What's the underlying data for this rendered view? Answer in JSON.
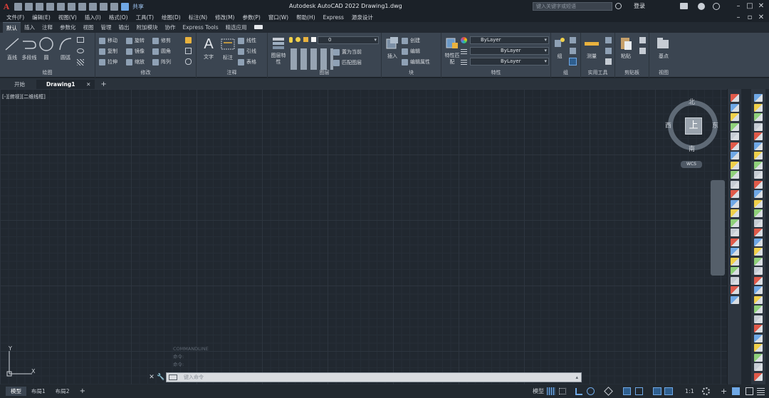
{
  "app": {
    "logo": "A",
    "title": "Autodesk AutoCAD 2022    Drawing1.dwg",
    "share": "共享",
    "search_placeholder": "键入关键字或短语",
    "login": "登录"
  },
  "menu": [
    "文件(F)",
    "编辑(E)",
    "视图(V)",
    "插入(I)",
    "格式(O)",
    "工具(T)",
    "绘图(D)",
    "标注(N)",
    "修改(M)",
    "参数(P)",
    "窗口(W)",
    "帮助(H)",
    "Express",
    "源泉设计"
  ],
  "ribbon_tabs": [
    "默认",
    "插入",
    "注释",
    "参数化",
    "视图",
    "管理",
    "输出",
    "附加模块",
    "协作",
    "Express Tools",
    "精选应用"
  ],
  "ribbon": {
    "draw": {
      "label": "绘图",
      "line": "直线",
      "polyline": "多段线",
      "circle": "圆",
      "arc": "圆弧"
    },
    "modify": {
      "label": "修改",
      "move": "移动",
      "rotate": "旋转",
      "trim": "修剪",
      "copy": "复制",
      "mirror": "镜像",
      "fillet": "圆角",
      "stretch": "拉伸",
      "scale": "缩放",
      "array": "阵列"
    },
    "annotation": {
      "label": "注释",
      "text": "文字",
      "dimension": "标注",
      "linear": "线性",
      "leader": "引线",
      "table": "表格"
    },
    "layers": {
      "label": "图层",
      "layer_props": "图层特性",
      "current_layer": "0",
      "make_current": "置为当前",
      "match_layer": "匹配图层"
    },
    "block": {
      "label": "块",
      "insert": "插入",
      "create": "创建",
      "edit": "编辑",
      "edit_attr": "编辑属性"
    },
    "properties": {
      "label": "特性",
      "match": "特性匹配",
      "color": "ByLayer",
      "linetype": "ByLayer",
      "lineweight": "ByLayer"
    },
    "groups": {
      "label": "组",
      "group": "组"
    },
    "utilities": {
      "label": "实用工具",
      "measure": "测量"
    },
    "clipboard": {
      "label": "剪贴板",
      "paste": "粘贴"
    },
    "view": {
      "label": "视图",
      "base": "基点"
    }
  },
  "file_tabs": [
    "开始",
    "Drawing1"
  ],
  "viewport_label": "[-][俯视][二维线框]",
  "viewcube": {
    "face": "上",
    "north": "北",
    "south": "南",
    "east": "东",
    "west": "西",
    "wcs": "WCS"
  },
  "ucs": {
    "x": "X",
    "y": "Y"
  },
  "command_history": [
    "COMMANDLINE",
    "命令:",
    "命令:"
  ],
  "command_placeholder": "键入命令",
  "layout_tabs": [
    "模型",
    "布局1",
    "布局2"
  ],
  "status": {
    "model": "模型",
    "scale": "1:1"
  }
}
